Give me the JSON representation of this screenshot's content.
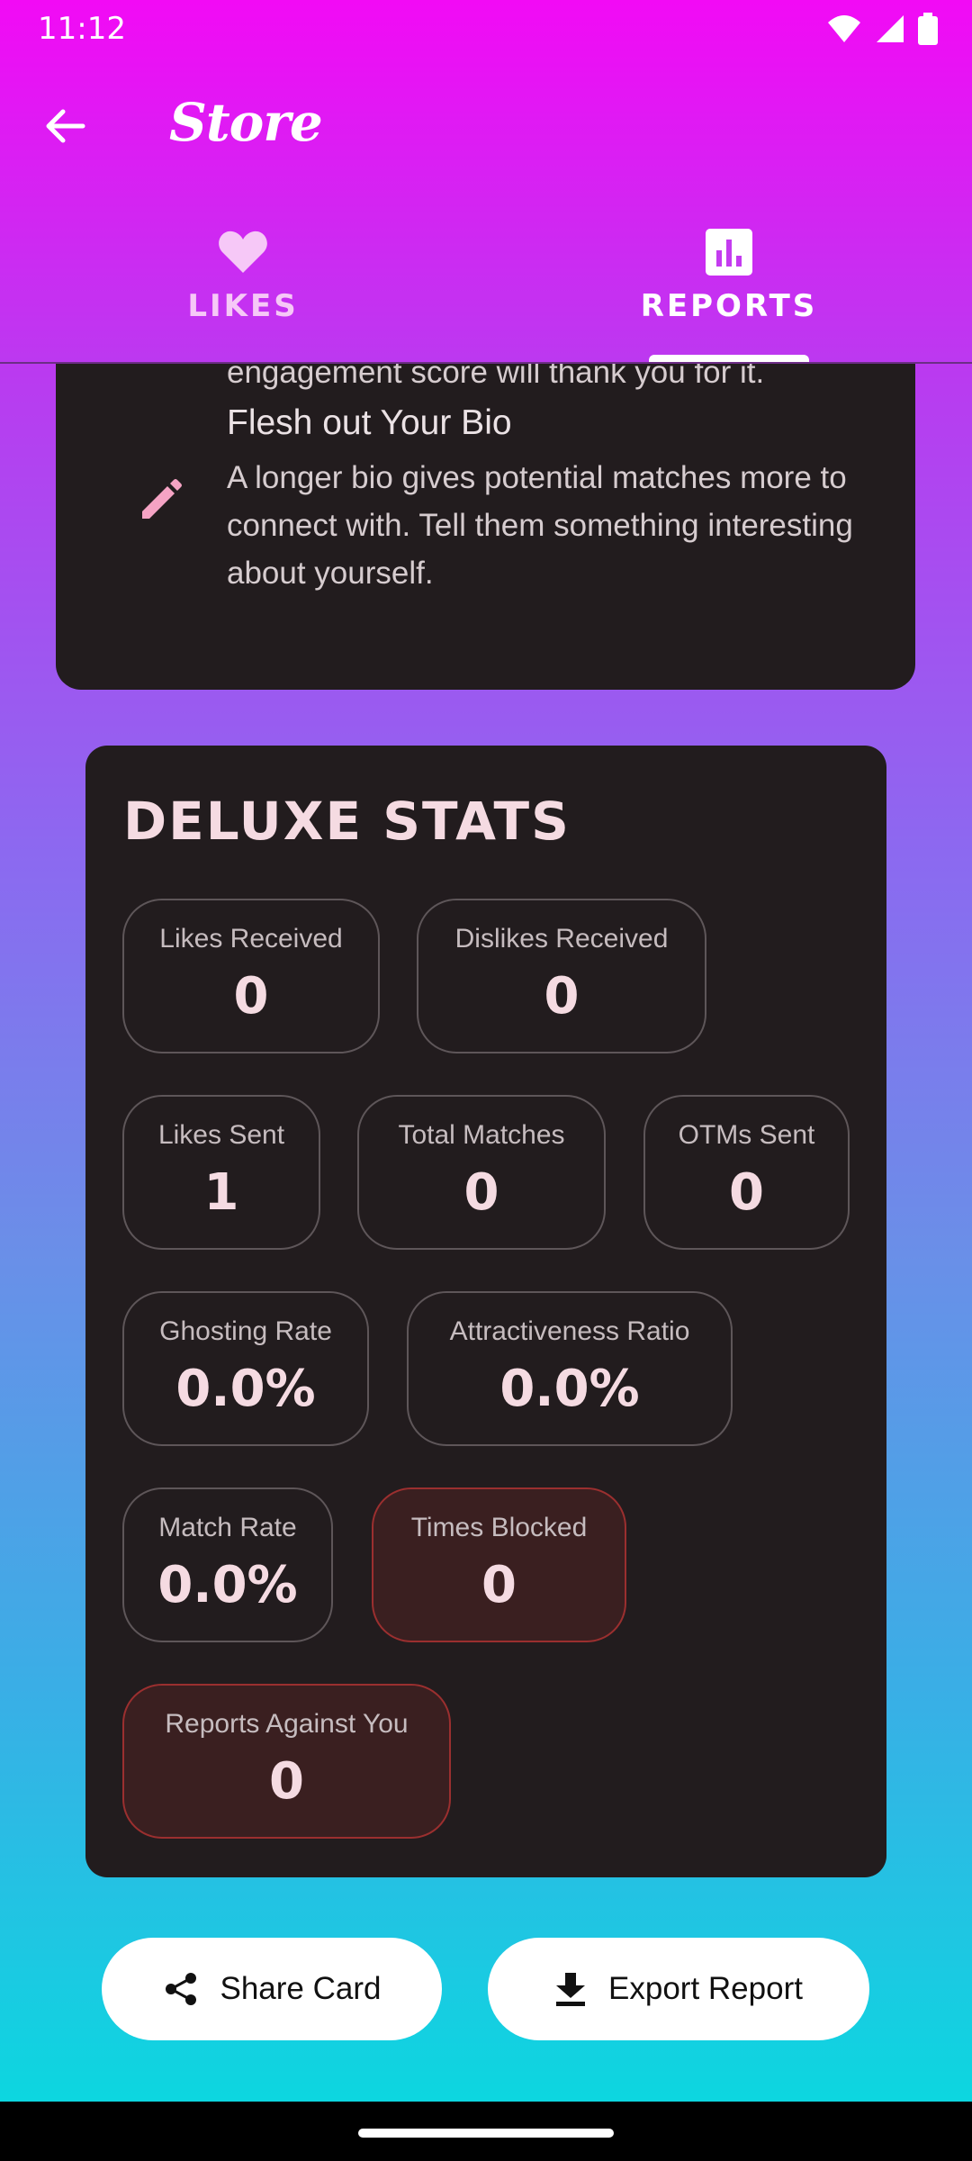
{
  "status_bar": {
    "time": "11:12"
  },
  "app_bar": {
    "title": "Store"
  },
  "tabs": [
    {
      "label": "LIKES",
      "icon": "heart-icon",
      "selected": false
    },
    {
      "label": "REPORTS",
      "icon": "bar-chart-icon",
      "selected": true
    }
  ],
  "tips": {
    "previous_tail": "engagement score will thank you for it.",
    "items": [
      {
        "title": "Flesh out Your Bio",
        "body": "A longer bio gives potential matches more to connect with. Tell them something interesting about yourself.",
        "icon": "pencil-icon"
      }
    ]
  },
  "stats": {
    "title": "DELUXE STATS",
    "items": [
      {
        "label": "Likes Received",
        "value": "0"
      },
      {
        "label": "Dislikes Received",
        "value": "0"
      },
      {
        "label": "Likes Sent",
        "value": "1"
      },
      {
        "label": "Total Matches",
        "value": "0"
      },
      {
        "label": "OTMs Sent",
        "value": "0"
      },
      {
        "label": "Ghosting Rate",
        "value": "0.0%"
      },
      {
        "label": "Attractiveness Ratio",
        "value": "0.0%"
      },
      {
        "label": "Match Rate",
        "value": "0.0%"
      },
      {
        "label": "Times Blocked",
        "value": "0",
        "warning": true
      },
      {
        "label": "Reports Against You",
        "value": "0",
        "warning": true
      }
    ]
  },
  "actions": {
    "share": {
      "label": "Share Card",
      "icon": "share-icon"
    },
    "export": {
      "label": "Export Report",
      "icon": "download-icon"
    }
  },
  "colors": {
    "card_bg": "#221c1e",
    "warning_border": "#9b2f2f",
    "warning_bg": "#3a1f20",
    "stat_value": "#f5dbe2",
    "accent_pink": "#f5a3c4"
  }
}
